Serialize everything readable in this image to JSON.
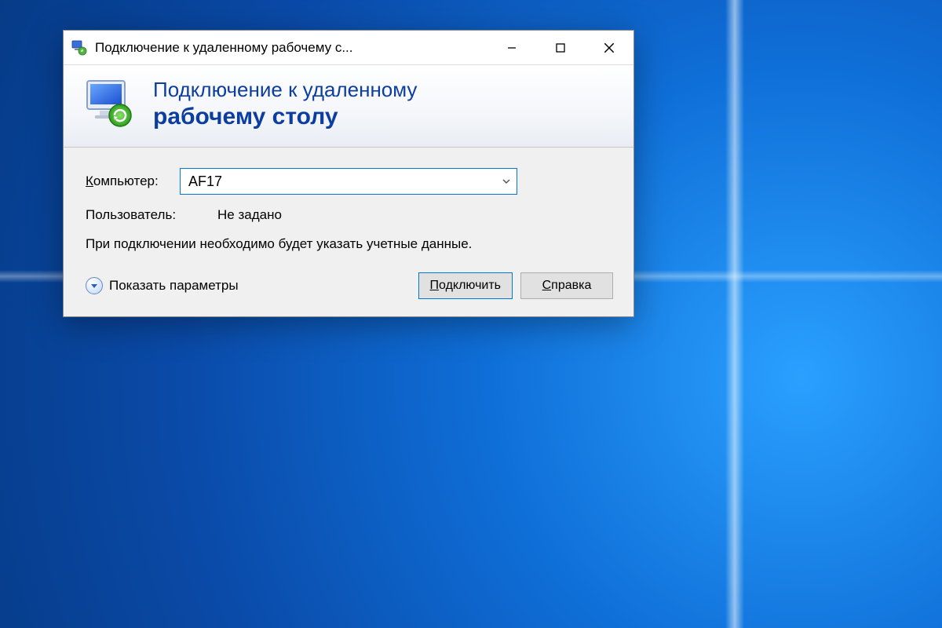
{
  "window": {
    "title": "Подключение к удаленному рабочему с..."
  },
  "banner": {
    "line1": "Подключение к удаленному",
    "line2": "рабочему столу"
  },
  "form": {
    "computer_label_prefix": "К",
    "computer_label_rest": "омпьютер:",
    "computer_value": "AF17",
    "user_label": "Пользователь:",
    "user_value": "Не задано",
    "info_text": "При подключении необходимо будет указать учетные данные."
  },
  "footer": {
    "show_options_prefix": "П",
    "show_options_rest": "оказать параметры",
    "connect_prefix": "П",
    "connect_rest": "одключить",
    "help_prefix": "С",
    "help_rest": "правка"
  }
}
